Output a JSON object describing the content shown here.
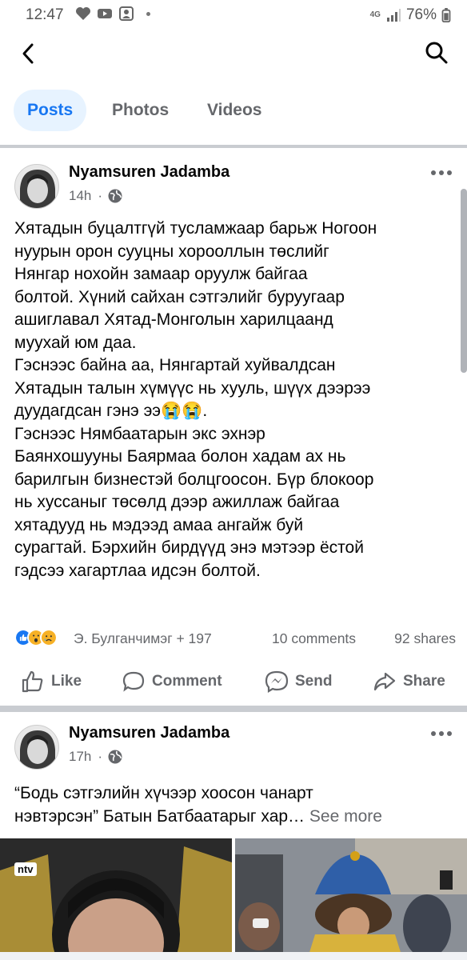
{
  "status_bar": {
    "time": "12:47",
    "network": "4G",
    "battery": "76%"
  },
  "tabs": [
    {
      "label": "Posts",
      "active": true
    },
    {
      "label": "Photos",
      "active": false
    },
    {
      "label": "Videos",
      "active": false
    }
  ],
  "posts": [
    {
      "author": "Nyamsuren Jadamba",
      "time": "14h",
      "text": "Хятадын буцалтгүй тусламжаар барьж Ногоон\nнуурын орон сууцны хорооллын төслийг\nНянгар нохойн замаар оруулж байгаа\nболтой. Хүний сайхан сэтгэлийг буруугаар\nашиглавал Хятад-Монголын харилцаанд\nмуухай юм даа.\nГэснээс байна аа, Нянгартай хуйвалдсан\nХятадын талын хүмүүс нь хууль, шүүх дээрээ\nдуудагдсан гэнэ ээ😭😭.\nГэснээс Нямбаатарын экс эхнэр\nБаянхошууны Баярмаа болон хадам ах нь\nбарилгын бизнестэй болцгоосон. Бүр блокоор\nнь хуссаныг төсөлд дээр ажиллаж байгаа\nхятадууд нь мэдээд амаа ангайж буй\nсурагтай. Бэрхийн бирдүүд энэ мэтээр ёстой\nгэдсээ хагартлаа идсэн болтой.",
      "reactions": "Э. Булганчимэг + 197",
      "comments": "10 comments",
      "shares": "92 shares"
    },
    {
      "author": "Nyamsuren Jadamba",
      "time": "17h",
      "text_line1": "“Бодь сэтгэлийн хүчээр хоосон чанарт",
      "text_line2": "нэвтэрсэн”  Батын Батбаатарыг хар…",
      "see_more": "See more",
      "photo_badge": "ntv"
    }
  ],
  "actions": {
    "like": "Like",
    "comment": "Comment",
    "send": "Send",
    "share": "Share"
  },
  "colors": {
    "accent": "#1877f2",
    "muted": "#65676b",
    "tab_bg": "#e7f3ff"
  }
}
